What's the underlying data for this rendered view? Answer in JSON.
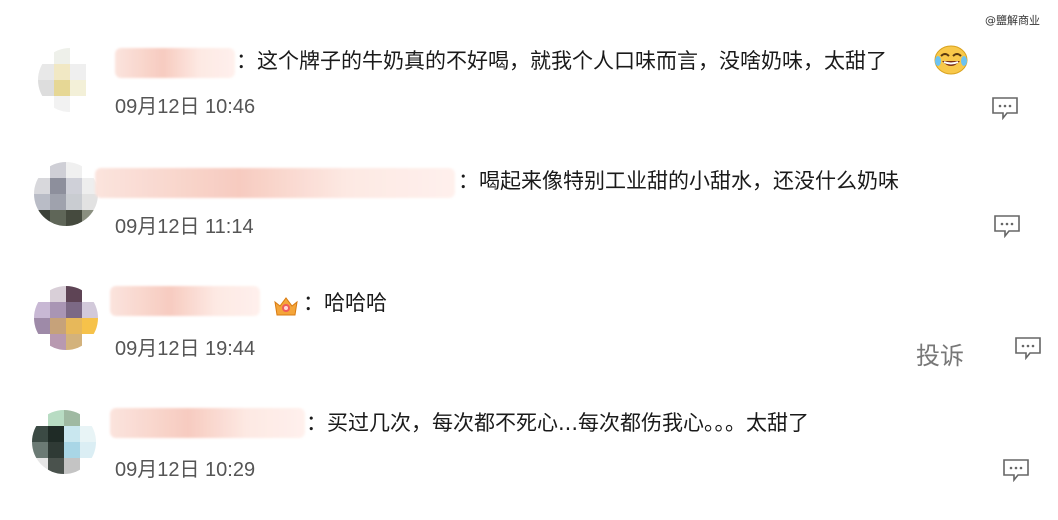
{
  "watermark": "@鹽解商业",
  "comments": [
    {
      "text": "：这个牌子的牛奶真的不好喝，就我个人口味而言，没啥奶味，太甜了",
      "time": "09月12日 10:46",
      "emoji": "laughing-tears-emoji",
      "reply_icon": "comment-icon"
    },
    {
      "text": "：喝起来像特别工业甜的小甜水，还没什么奶味",
      "time": "09月12日 11:14",
      "reply_icon": "comment-icon"
    },
    {
      "text": "：哈哈哈",
      "time": "09月12日 19:44",
      "badge": "crown-badge-icon",
      "report_label": "投诉",
      "reply_icon": "comment-icon"
    },
    {
      "text": "：买过几次，每次都不死心...每次都伤我心。。。太甜了",
      "time": "09月12日 10:29",
      "reply_icon": "comment-icon"
    }
  ]
}
